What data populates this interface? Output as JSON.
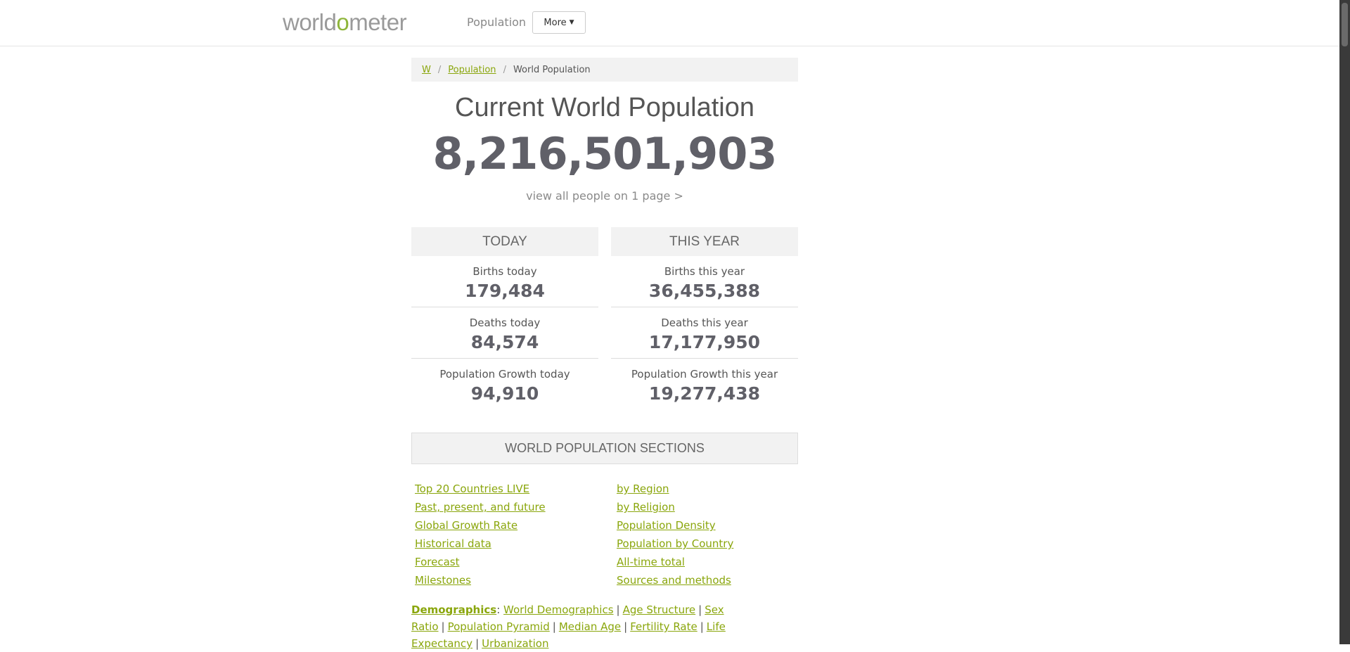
{
  "nav": {
    "logo_prefix": "world",
    "logo_o": "o",
    "logo_suffix": "meter",
    "population_link": "Population",
    "more_label": "More"
  },
  "breadcrumb": {
    "home": "W",
    "sep": "/",
    "population": "Population",
    "current": "World Population"
  },
  "main": {
    "title": "Current World Population",
    "counter": "8,216,501,903",
    "view_all": "view all people on 1 page >"
  },
  "today": {
    "header": "TODAY",
    "stats": [
      {
        "label": "Births today",
        "value": "179,484"
      },
      {
        "label": "Deaths today",
        "value": "84,574"
      },
      {
        "label": "Population Growth today",
        "value": "94,910"
      }
    ]
  },
  "this_year": {
    "header": "THIS YEAR",
    "stats": [
      {
        "label": "Births this year",
        "value": "36,455,388"
      },
      {
        "label": "Deaths this year",
        "value": "17,177,950"
      },
      {
        "label": "Population Growth this year",
        "value": "19,277,438"
      }
    ]
  },
  "sections": {
    "header": "WORLD POPULATION SECTIONS",
    "left": [
      "Top 20 Countries LIVE",
      "Past, present, and future",
      "Global Growth Rate",
      "Historical data",
      "Forecast",
      "Milestones"
    ],
    "right": [
      "by Region",
      "by Religion",
      "Population Density",
      "Population by Country",
      "All-time total",
      "Sources and methods"
    ]
  },
  "demographics": {
    "label": "Demographics",
    "colon": ":",
    "pipe": "|",
    "links": [
      "World Demographics",
      "Age Structure",
      "Sex Ratio",
      "Population Pyramid",
      "Median Age",
      "Fertility Rate",
      "Life Expectancy",
      "Urbanization"
    ]
  },
  "colors": {
    "link_green": "#8aa60c",
    "logo_gray": "#9a9a9a",
    "counter_gray": "#606068"
  }
}
